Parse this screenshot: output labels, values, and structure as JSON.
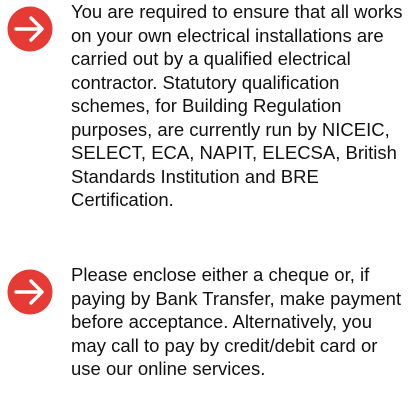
{
  "colors": {
    "icon_background": "#e63a35",
    "icon_arrow": "#ffffff",
    "text": "#111111"
  },
  "notices": [
    {
      "icon": "arrow-right-icon",
      "text": "You are required to ensure that all works on your own electrical installations are carried out by a qualified electrical contractor. Statutory qualification schemes, for Building Regulation purposes, are currently run by NICEIC, SELECT, ECA, NAPIT, ELECSA, British Standards Institution and BRE Certification."
    },
    {
      "icon": "arrow-right-icon",
      "text": "Please enclose either a cheque or, if paying by Bank Transfer, make payment before acceptance. Alternatively, you may call to pay by credit/debit card or use our online services."
    }
  ]
}
